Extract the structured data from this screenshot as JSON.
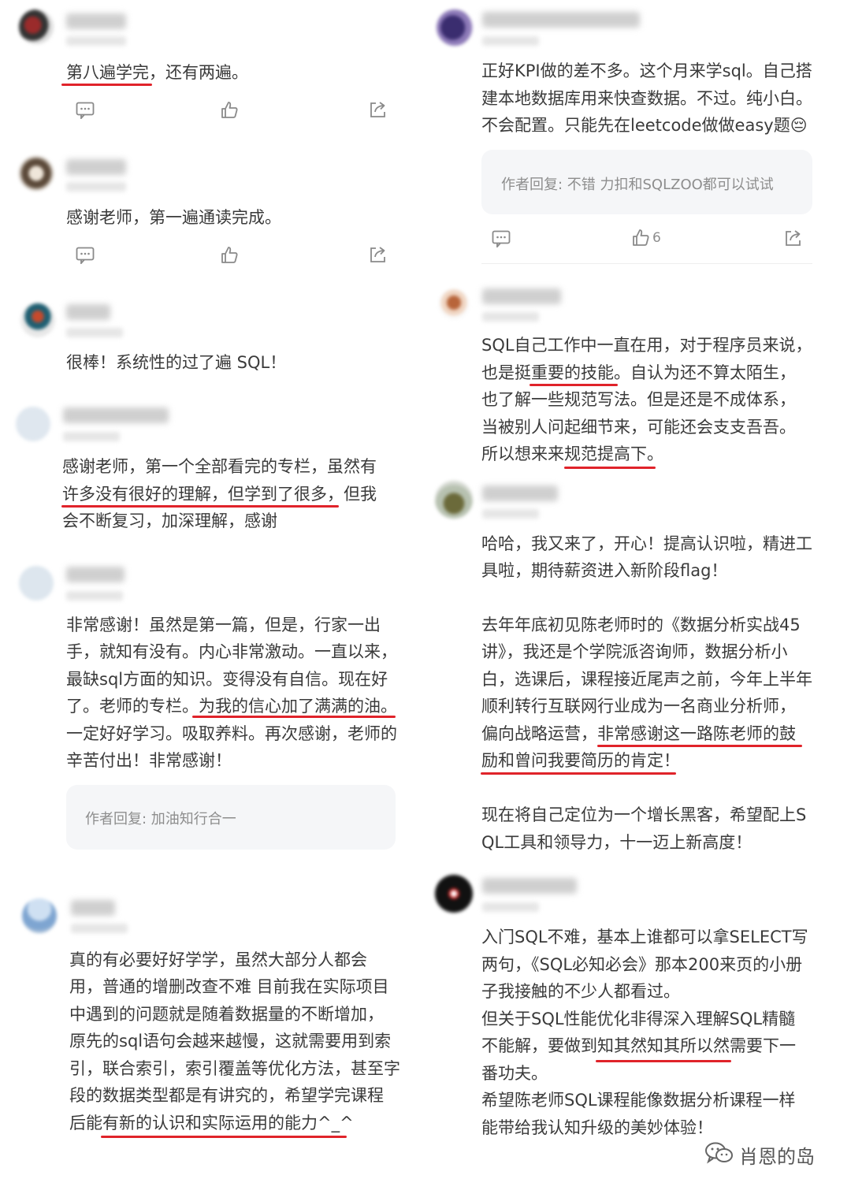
{
  "watermark": "肖恩的岛",
  "left": [
    {
      "lines": [
        "第八遍学完，还有两遍。"
      ],
      "actions": true
    },
    {
      "lines": [
        "感谢老师，第一遍通读完成。"
      ],
      "actions": true
    },
    {
      "lines": [
        "很棒！系统性的过了遍 SQL！"
      ]
    },
    {
      "lines": [
        "感谢老师，第一个全部看完的专栏，虽然有",
        "许多没有很好的理解，但学到了很多，但我",
        "会不断复习，加深理解，感谢"
      ]
    },
    {
      "lines": [
        "非常感谢！虽然是第一篇，但是，行家一出",
        "手，就知有没有。内心非常激动。一直以来，",
        "最缺sql方面的知识。变得没有自信。现在好",
        "了。老师的专栏。为我的信心加了满满的油。",
        "一定好好学习。吸取养料。再次感谢，老师的",
        "辛苦付出！非常感谢！"
      ],
      "reply": "作者回复: 加油知行合一"
    },
    {
      "lines": [
        "真的有必要好好学学，虽然大部分人都会",
        "用，普通的增删改查不难 目前我在实际项目",
        "中遇到的问题就是随着数据量的不断增加，",
        "原先的sql语句会越来越慢，这就需要用到索",
        "引，联合索引，索引覆盖等优化方法，甚至字",
        "段的数据类型都是有讲究的，希望学完课程",
        "后能有新的认识和实际运用的能力^_^"
      ]
    }
  ],
  "right": [
    {
      "lines": [
        "正好KPI做的差不多。这个月来学sql。自己搭",
        "建本地数据库用来快查数据。不过。纯小白。",
        "不会配置。只能先在leetcode做做easy题😔"
      ],
      "reply": "作者回复: 不错 力扣和SQLZOO都可以试试",
      "like_count": "6",
      "actions": true
    },
    {
      "lines": [
        "SQL自己工作中一直在用，对于程序员来说，",
        "也是挺重要的技能。自认为还不算太陌生，",
        "也了解一些规范写法。但是还是不成体系，",
        "当被别人问起细节来，可能还会支支吾吾。",
        "所以想来来规范提高下。"
      ]
    },
    {
      "lines": [
        "哈哈，我又来了，开心！提高认识啦，精进工",
        "具啦，期待薪资进入新阶段flag！"
      ]
    },
    {
      "lines": [
        "去年年底初见陈老师时的《数据分析实战45",
        "讲》，我还是个学院派咨询师，数据分析小",
        "白，选课后，课程接近尾声之前，今年上半年",
        "顺利转行互联网行业成为一名商业分析师，",
        "偏向战略运营，非常感谢这一路陈老师的鼓",
        "励和曾问我要简历的肯定！"
      ]
    },
    {
      "lines": [
        "现在将自己定位为一个增长黑客，希望配上S",
        "QL工具和领导力，十一迈上新高度！"
      ]
    },
    {
      "lines": [
        "入门SQL不难，基本上谁都可以拿SELECT写",
        "两句，《SQL必知必会》那本200来页的小册",
        "子我接触的不少人都看过。",
        "但关于SQL性能优化非得深入理解SQL精髓",
        "不能解，要做到知其然知其所以然需要下一",
        "番功夫。",
        "希望陈老师SQL课程能像数据分析课程一样",
        "能带给我认知升级的美妙体验！"
      ]
    }
  ]
}
